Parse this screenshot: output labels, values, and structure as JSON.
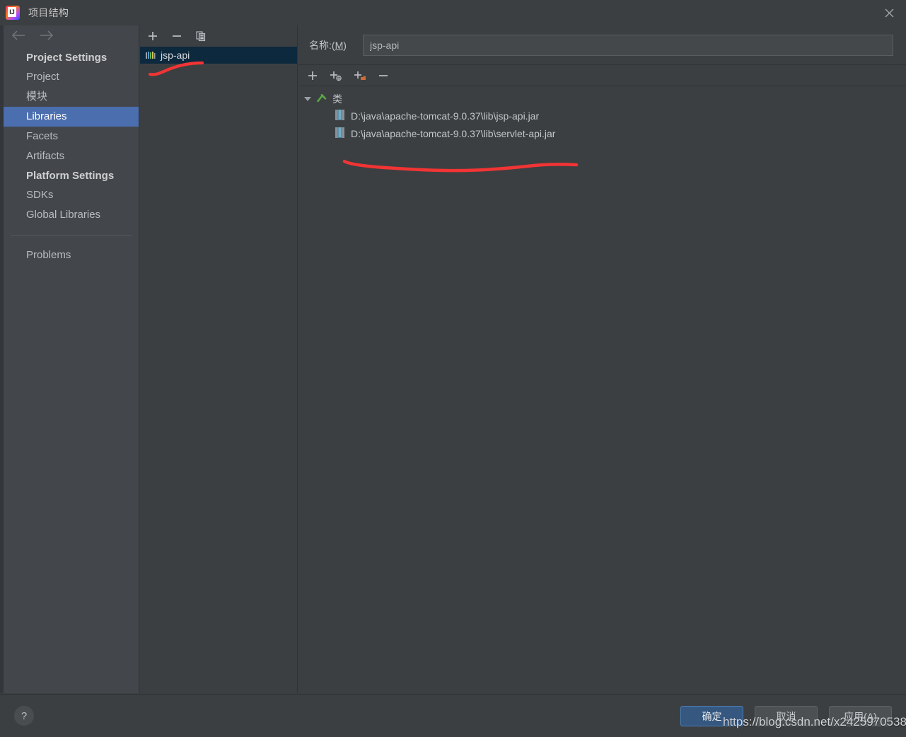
{
  "window": {
    "title": "项目结构",
    "app_icon": "intellij-idea-logo",
    "close_icon": "close-icon"
  },
  "sidebar": {
    "back_icon": "arrow-left-icon",
    "forward_icon": "arrow-right-icon",
    "groups": [
      {
        "title": "Project Settings",
        "items": [
          {
            "label": "Project",
            "selected": false
          },
          {
            "label": "模块",
            "selected": false
          },
          {
            "label": "Libraries",
            "selected": true
          },
          {
            "label": "Facets",
            "selected": false
          },
          {
            "label": "Artifacts",
            "selected": false
          }
        ]
      },
      {
        "title": "Platform Settings",
        "items": [
          {
            "label": "SDKs",
            "selected": false
          },
          {
            "label": "Global Libraries",
            "selected": false
          }
        ]
      }
    ],
    "footer_items": [
      {
        "label": "Problems",
        "selected": false
      }
    ]
  },
  "library_panel": {
    "toolbar": [
      {
        "name": "add-library-button",
        "icon": "plus-icon",
        "label": "+"
      },
      {
        "name": "remove-library-button",
        "icon": "minus-icon",
        "label": "−"
      },
      {
        "name": "copy-library-button",
        "icon": "copy-icon",
        "label": "copy"
      }
    ],
    "items": [
      {
        "label": "jsp-api",
        "icon": "library-icon",
        "selected": true
      }
    ]
  },
  "details": {
    "name_label_prefix": "名称:(",
    "name_label_mnemonic": "M",
    "name_label_suffix": ")",
    "name_value": "jsp-api",
    "toolbar": [
      {
        "name": "add-classes-button",
        "icon": "plus-icon",
        "label": "+"
      },
      {
        "name": "add-from-maven-button",
        "icon": "plus-globe-icon",
        "label": "+"
      },
      {
        "name": "add-from-folder-button",
        "icon": "plus-folder-icon",
        "label": "+"
      },
      {
        "name": "remove-entry-button",
        "icon": "minus-icon",
        "label": "−"
      }
    ],
    "tree": {
      "root": {
        "label": "类",
        "icon": "classes-root-icon",
        "expanded": true
      },
      "children": [
        {
          "label": "D:\\java\\apache-tomcat-9.0.37\\lib\\jsp-api.jar",
          "icon": "jar-file-icon"
        },
        {
          "label": "D:\\java\\apache-tomcat-9.0.37\\lib\\servlet-api.jar",
          "icon": "jar-file-icon"
        }
      ]
    }
  },
  "footer": {
    "help_label": "?",
    "help_icon": "help-icon",
    "buttons": [
      {
        "name": "ok-button",
        "label": "确定",
        "primary": true
      },
      {
        "name": "cancel-button",
        "label": "取消",
        "primary": false
      },
      {
        "name": "apply-button",
        "label": "应用(A)",
        "primary": false
      }
    ]
  },
  "annotations": {
    "watermark": "https://blog.csdn.net/x2425970538",
    "stroke_color": "#f23434"
  },
  "colors": {
    "dialog_bg": "#3c3f41",
    "sidebar_bg": "#43474c",
    "selection_blue": "#4b6eaf",
    "list_selection": "#0d293e",
    "primary_button": "#365880",
    "text": "#b9bcc0"
  }
}
